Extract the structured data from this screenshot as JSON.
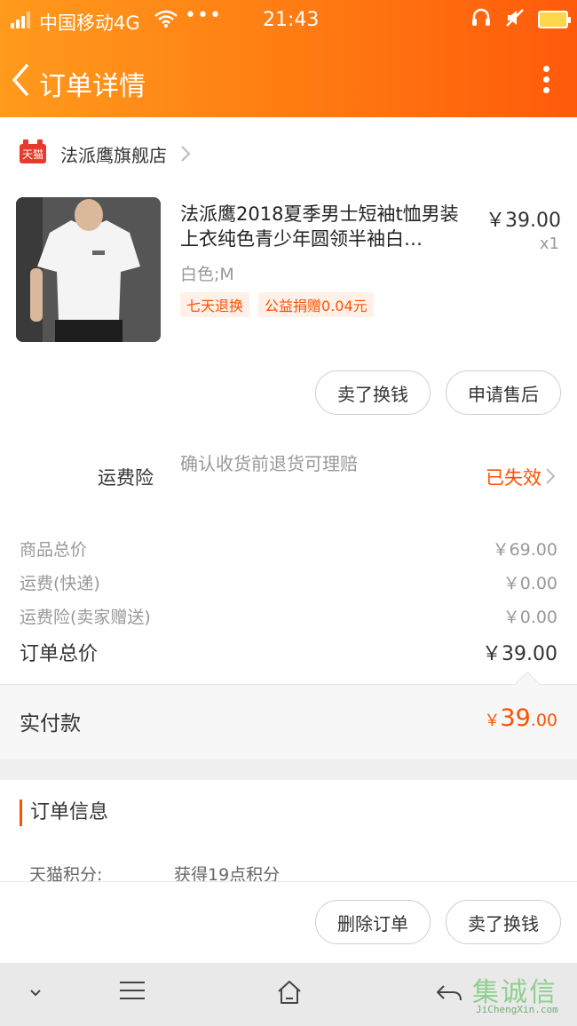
{
  "status_bar": {
    "carrier": "中国移动4G",
    "dots": "•••",
    "time": "21:43"
  },
  "header": {
    "title": "订单详情"
  },
  "shop": {
    "badge": "天猫",
    "name": "法派鹰旗舰店"
  },
  "product": {
    "title": "法派鹰2018夏季男士短袖t恤男装上衣纯色青少年圆领半袖白…",
    "price": "￥39.00",
    "quantity": "x1",
    "sku": "白色;M",
    "tags": [
      "七天退换",
      "公益捐赠0.04元"
    ]
  },
  "product_actions": {
    "sell_label": "卖了换钱",
    "after_sale_label": "申请售后"
  },
  "insurance": {
    "label": "运费险",
    "description": "确认收货前退货可理赔",
    "status": "已失效"
  },
  "summary": {
    "rows": [
      {
        "label": "商品总价",
        "value": "￥69.00"
      },
      {
        "label": "运费(快递)",
        "value": "￥0.00"
      },
      {
        "label": "运费险(卖家赠送)",
        "value": "￥0.00"
      }
    ],
    "total_label": "订单总价",
    "total_value": "￥39.00"
  },
  "paid": {
    "label": "实付款",
    "currency": "￥",
    "integer": "39",
    "decimal": ".00"
  },
  "order_info": {
    "title": "订单信息",
    "points_key": "天猫积分:",
    "points_value": "获得19点积分"
  },
  "bottom_actions": {
    "delete_label": "删除订单",
    "sell_label": "卖了换钱"
  },
  "watermark": {
    "chars": "集诚信",
    "url": "JiChengXin.com"
  },
  "colors": {
    "accent": "#ff5000",
    "header_start": "#ff9a1c",
    "header_end": "#ff5a0a",
    "tmall_red": "#e83a2c"
  }
}
